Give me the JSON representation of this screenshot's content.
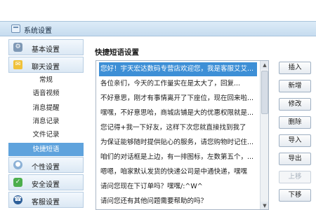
{
  "window": {
    "title": "系统设置"
  },
  "sidebar": {
    "categories": [
      {
        "label": "基本设置",
        "icon": "settings-icon"
      },
      {
        "label": "聊天设置",
        "icon": "chat-icon"
      },
      {
        "label": "个性设置",
        "icon": "person-icon"
      },
      {
        "label": "安全设置",
        "icon": "shield-icon"
      },
      {
        "label": "客服设置",
        "icon": "service-icon"
      }
    ],
    "chat_subitems": [
      "常规",
      "语音视频",
      "消息提醒",
      "消息记录",
      "文件记录",
      "快捷短语"
    ],
    "selected_subitem": "快捷短语"
  },
  "main": {
    "section_title": "快捷短语设置",
    "phrases": [
      "您好！宇天宏达数码专营店欢迎您，我是客服艾艾...",
      "各位亲们，今天的工作量实在是太大了，回复...",
      "不好意思，刚才有事情离开了下座位，现在回来啦...",
      "嘿嘿，不好意思哈，商城店铺是大的优惠权限就是...",
      "您记得+我一下好友，这样下次您就直接找到我了",
      "为保证能够随时提供贴心的服务，请您购物时记住...",
      "咱们的对话框是上边，有一排图标，左数第五个，...",
      "嗯嗯，咱家默认发货的快递公司是中通快递，嘿嘿",
      "请问您现在下订单吗？嘿嘿/:^W^",
      "请问您还有其他问题需要帮助的吗？"
    ],
    "selected_index": 0
  },
  "buttons": {
    "insert": "插入",
    "add": "新增",
    "edit": "修改",
    "delete": "删除",
    "import": "导入",
    "export": "导出",
    "move_up": "上移",
    "move_down": "下移"
  }
}
